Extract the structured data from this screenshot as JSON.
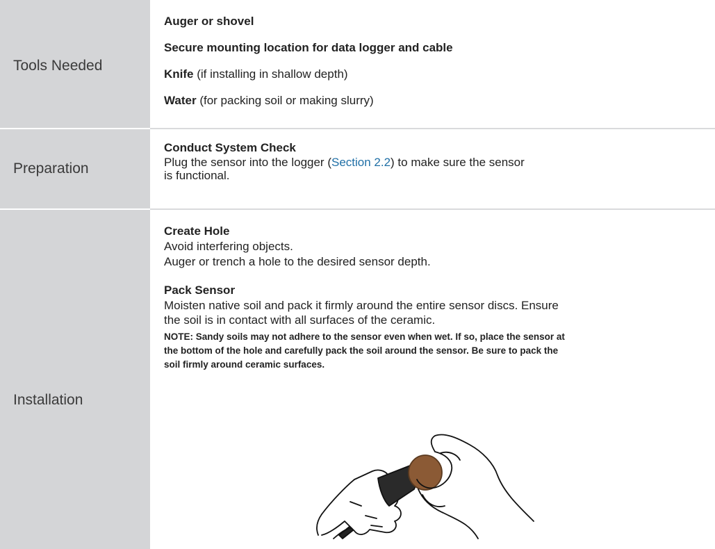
{
  "rows": {
    "tools": {
      "label": "Tools Needed",
      "items": [
        {
          "bold": "Auger or shovel",
          "rest": ""
        },
        {
          "bold": "Secure mounting location for data logger and cable",
          "rest": ""
        },
        {
          "bold": "Knife",
          "rest": " (if installing in shallow depth)"
        },
        {
          "bold": "Water",
          "rest": " (for packing soil or making slurry)"
        }
      ]
    },
    "preparation": {
      "label": "Preparation",
      "heading": "Conduct System Check",
      "line1_pre": "Plug the sensor into the logger (",
      "line1_link": "Section 2.2",
      "line1_post": ") to make sure the sensor",
      "line2": "is functional."
    },
    "installation": {
      "label": "Installation",
      "create_hole": {
        "heading": "Create Hole",
        "lines": [
          "Avoid interfering objects.",
          "Auger or trench a hole to the desired sensor depth."
        ]
      },
      "pack_sensor": {
        "heading": "Pack Sensor",
        "lines": [
          "Moisten native soil and pack it firmly around the entire sensor discs. Ensure",
          "the soil is in contact with all surfaces of the ceramic."
        ]
      },
      "note_lines": [
        "NOTE:  Sandy soils may not adhere to the sensor even when wet. If so, place the sensor at",
        "the bottom of the hole and carefully pack the soil around the sensor. Be sure to pack the",
        "soil firmly around ceramic surfaces."
      ]
    }
  },
  "colors": {
    "label_bg": "#d4d5d7",
    "link": "#1f6fa6",
    "soil": "#8b5a35"
  }
}
